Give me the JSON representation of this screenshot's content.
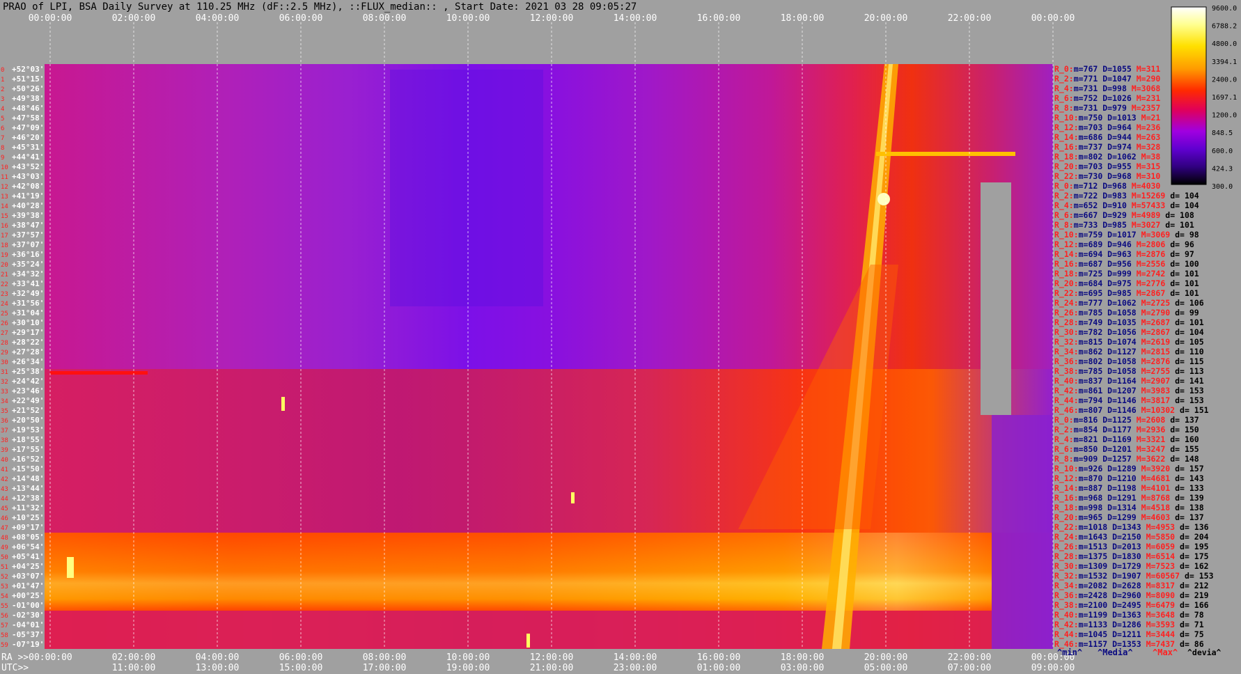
{
  "title": "PRAO of LPI, BSA Daily Survey at 110.25 MHz (dF::2.5 MHz), ::FLUX_median:: , Start Date: 2021 03 28 09:05:27",
  "chart_data": {
    "type": "heatmap",
    "top_ticks": [
      "00:00:00",
      "02:00:00",
      "04:00:00",
      "06:00:00",
      "08:00:00",
      "10:00:00",
      "12:00:00",
      "14:00:00",
      "16:00:00",
      "18:00:00",
      "20:00:00",
      "22:00:00",
      "00:00:00"
    ],
    "bottom_ra_ticks": [
      "RA >>00:00:00",
      "02:00:00",
      "04:00:00",
      "06:00:00",
      "08:00:00",
      "10:00:00",
      "12:00:00",
      "14:00:00",
      "16:00:00",
      "18:00:00",
      "20:00:00",
      "22:00:00",
      "00:00:00"
    ],
    "bottom_utc_ticks": [
      "UTC>>",
      "11:00:00",
      "13:00:00",
      "15:00:00",
      "17:00:00",
      "19:00:00",
      "21:00:00",
      "23:00:00",
      "01:00:00",
      "03:00:00",
      "05:00:00",
      "07:00:00",
      "09:00:00"
    ],
    "colorbar_ticks": [
      "9600.0",
      "6788.2",
      "4800.0",
      "3394.1",
      "2400.0",
      "1697.1",
      "1200.0",
      "848.5",
      "600.0",
      "424.3",
      "300.0"
    ],
    "declinations": [
      "+52°03'",
      "+51°15'",
      "+50°26'",
      "+49°38'",
      "+48°46'",
      "+47°58'",
      "+47°09'",
      "+46°20'",
      "+45°31'",
      "+44°41'",
      "+43°52'",
      "+43°03'",
      "+42°08'",
      "+41°19'",
      "+40°28'",
      "+39°38'",
      "+38°47'",
      "+37°57'",
      "+37°07'",
      "+36°16'",
      "+35°24'",
      "+34°32'",
      "+33°41'",
      "+32°49'",
      "+31°56'",
      "+31°04'",
      "+30°10'",
      "+29°17'",
      "+28°22'",
      "+27°28'",
      "+26°34'",
      "+25°38'",
      "+24°42'",
      "+23°46'",
      "+22°49'",
      "+21°52'",
      "+20°50'",
      "+19°53'",
      "+18°55'",
      "+17°55'",
      "+16°52'",
      "+15°50'",
      "+14°48'",
      "+13°44'",
      "+12°38'",
      "+11°32'",
      "+10°25'",
      "+09°17'",
      "+08°05'",
      "+06°54'",
      "+05°41'",
      "+04°25'",
      "+03°07'",
      "+01°47'",
      "+00°25'",
      "-01°00'",
      "-02°30'",
      "-04°01'",
      "-05°37'",
      "-07°19'"
    ],
    "stats": [
      {
        "r": "R_0:",
        "m": "m=767",
        "D": "D=1055",
        "M": "M=311",
        "d": ""
      },
      {
        "r": "R_2:",
        "m": "m=771",
        "D": "D=1047",
        "M": "M=290",
        "d": ""
      },
      {
        "r": "R_4:",
        "m": "m=731",
        "D": "D=998",
        "M": "M=3068",
        "d": ""
      },
      {
        "r": "R_6:",
        "m": "m=752",
        "D": "D=1026",
        "M": "M=231",
        "d": ""
      },
      {
        "r": "R_8:",
        "m": "m=731",
        "D": "D=979",
        "M": "M=2357",
        "d": ""
      },
      {
        "r": "R_10:",
        "m": "m=750",
        "D": "D=1013",
        "M": "M=21",
        "d": ""
      },
      {
        "r": "R_12:",
        "m": "m=703",
        "D": "D=964",
        "M": "M=236",
        "d": ""
      },
      {
        "r": "R_14:",
        "m": "m=686",
        "D": "D=944",
        "M": "M=263",
        "d": ""
      },
      {
        "r": "R_16:",
        "m": "m=737",
        "D": "D=974",
        "M": "M=328",
        "d": ""
      },
      {
        "r": "R_18:",
        "m": "m=802",
        "D": "D=1062",
        "M": "M=38",
        "d": ""
      },
      {
        "r": "R_20:",
        "m": "m=703",
        "D": "D=955",
        "M": "M=315",
        "d": ""
      },
      {
        "r": "R_22:",
        "m": "m=730",
        "D": "D=968",
        "M": "M=310",
        "d": ""
      },
      {
        "r": "R_0:",
        "m": "m=712",
        "D": "D=968",
        "M": "M=4030",
        "d": ""
      },
      {
        "r": "R_2:",
        "m": "m=722",
        "D": "D=983",
        "M": "M=15269",
        "d": "d= 104"
      },
      {
        "r": "R_4:",
        "m": "m=652",
        "D": "D=910",
        "M": "M=57433",
        "d": "d= 104"
      },
      {
        "r": "R_6:",
        "m": "m=667",
        "D": "D=929",
        "M": "M=4989",
        "d": "d= 108"
      },
      {
        "r": "R_8:",
        "m": "m=733",
        "D": "D=985",
        "M": "M=3027",
        "d": "d= 101"
      },
      {
        "r": "R_10:",
        "m": "m=759",
        "D": "D=1017",
        "M": "M=3069",
        "d": "d= 98"
      },
      {
        "r": "R_12:",
        "m": "m=689",
        "D": "D=946",
        "M": "M=2806",
        "d": "d= 96"
      },
      {
        "r": "R_14:",
        "m": "m=694",
        "D": "D=963",
        "M": "M=2876",
        "d": "d= 97"
      },
      {
        "r": "R_16:",
        "m": "m=687",
        "D": "D=956",
        "M": "M=2556",
        "d": "d= 100"
      },
      {
        "r": "R_18:",
        "m": "m=725",
        "D": "D=999",
        "M": "M=2742",
        "d": "d= 101"
      },
      {
        "r": "R_20:",
        "m": "m=684",
        "D": "D=975",
        "M": "M=2776",
        "d": "d= 101"
      },
      {
        "r": "R_22:",
        "m": "m=695",
        "D": "D=985",
        "M": "M=2867",
        "d": "d= 101"
      },
      {
        "r": "R_24:",
        "m": "m=777",
        "D": "D=1062",
        "M": "M=2725",
        "d": "d= 106"
      },
      {
        "r": "R_26:",
        "m": "m=785",
        "D": "D=1058",
        "M": "M=2790",
        "d": "d= 99"
      },
      {
        "r": "R_28:",
        "m": "m=749",
        "D": "D=1035",
        "M": "M=2687",
        "d": "d= 101"
      },
      {
        "r": "R_30:",
        "m": "m=782",
        "D": "D=1056",
        "M": "M=2867",
        "d": "d= 104"
      },
      {
        "r": "R_32:",
        "m": "m=815",
        "D": "D=1074",
        "M": "M=2619",
        "d": "d= 105"
      },
      {
        "r": "R_34:",
        "m": "m=862",
        "D": "D=1127",
        "M": "M=2815",
        "d": "d= 110"
      },
      {
        "r": "R_36:",
        "m": "m=802",
        "D": "D=1058",
        "M": "M=2876",
        "d": "d= 115"
      },
      {
        "r": "R_38:",
        "m": "m=785",
        "D": "D=1058",
        "M": "M=2755",
        "d": "d= 113"
      },
      {
        "r": "R_40:",
        "m": "m=837",
        "D": "D=1164",
        "M": "M=2907",
        "d": "d= 141"
      },
      {
        "r": "R_42:",
        "m": "m=861",
        "D": "D=1207",
        "M": "M=3983",
        "d": "d= 153"
      },
      {
        "r": "R_44:",
        "m": "m=794",
        "D": "D=1146",
        "M": "M=3817",
        "d": "d= 153"
      },
      {
        "r": "R_46:",
        "m": "m=807",
        "D": "D=1146",
        "M": "M=10302",
        "d": "d= 151"
      },
      {
        "r": "R_0:",
        "m": "m=816",
        "D": "D=1125",
        "M": "M=2608",
        "d": "d= 137"
      },
      {
        "r": "R_2:",
        "m": "m=854",
        "D": "D=1177",
        "M": "M=2936",
        "d": "d= 150"
      },
      {
        "r": "R_4:",
        "m": "m=821",
        "D": "D=1169",
        "M": "M=3321",
        "d": "d= 160"
      },
      {
        "r": "R_6:",
        "m": "m=850",
        "D": "D=1201",
        "M": "M=3247",
        "d": "d= 155"
      },
      {
        "r": "R_8:",
        "m": "m=909",
        "D": "D=1257",
        "M": "M=3622",
        "d": "d= 148"
      },
      {
        "r": "R_10:",
        "m": "m=926",
        "D": "D=1289",
        "M": "M=3920",
        "d": "d= 157"
      },
      {
        "r": "R_12:",
        "m": "m=870",
        "D": "D=1210",
        "M": "M=4681",
        "d": "d= 143"
      },
      {
        "r": "R_14:",
        "m": "m=887",
        "D": "D=1198",
        "M": "M=4101",
        "d": "d= 133"
      },
      {
        "r": "R_16:",
        "m": "m=968",
        "D": "D=1291",
        "M": "M=8768",
        "d": "d= 139"
      },
      {
        "r": "R_18:",
        "m": "m=998",
        "D": "D=1314",
        "M": "M=4518",
        "d": "d= 138"
      },
      {
        "r": "R_20:",
        "m": "m=965",
        "D": "D=1299",
        "M": "M=4603",
        "d": "d= 137"
      },
      {
        "r": "R_22:",
        "m": "m=1018",
        "D": "D=1343",
        "M": "M=4953",
        "d": "d= 136"
      },
      {
        "r": "R_24:",
        "m": "m=1643",
        "D": "D=2150",
        "M": "M=5850",
        "d": "d= 204"
      },
      {
        "r": "R_26:",
        "m": "m=1513",
        "D": "D=2013",
        "M": "M=6059",
        "d": "d= 195"
      },
      {
        "r": "R_28:",
        "m": "m=1375",
        "D": "D=1830",
        "M": "M=6514",
        "d": "d= 175"
      },
      {
        "r": "R_30:",
        "m": "m=1309",
        "D": "D=1729",
        "M": "M=7523",
        "d": "d= 162"
      },
      {
        "r": "R_32:",
        "m": "m=1532",
        "D": "D=1907",
        "M": "M=60567",
        "d": "d= 153"
      },
      {
        "r": "R_34:",
        "m": "m=2082",
        "D": "D=2628",
        "M": "M=8317",
        "d": "d= 212"
      },
      {
        "r": "R_36:",
        "m": "m=2428",
        "D": "D=2960",
        "M": "M=8090",
        "d": "d= 219"
      },
      {
        "r": "R_38:",
        "m": "m=2100",
        "D": "D=2495",
        "M": "M=6479",
        "d": "d= 166"
      },
      {
        "r": "R_40:",
        "m": "m=1199",
        "D": "D=1363",
        "M": "M=3648",
        "d": "d= 78"
      },
      {
        "r": "R_42:",
        "m": "m=1133",
        "D": "D=1286",
        "M": "M=3593",
        "d": "d= 71"
      },
      {
        "r": "R_44:",
        "m": "m=1045",
        "D": "D=1211",
        "M": "M=3444",
        "d": "d= 75"
      },
      {
        "r": "R_46:",
        "m": "m=1157",
        "D": "D=1353",
        "M": "M=7437",
        "d": "d= 86"
      }
    ],
    "footer": {
      "min": "^min^",
      "median": "^Media^",
      "max": "^Max^",
      "devia": "^devia^"
    }
  }
}
